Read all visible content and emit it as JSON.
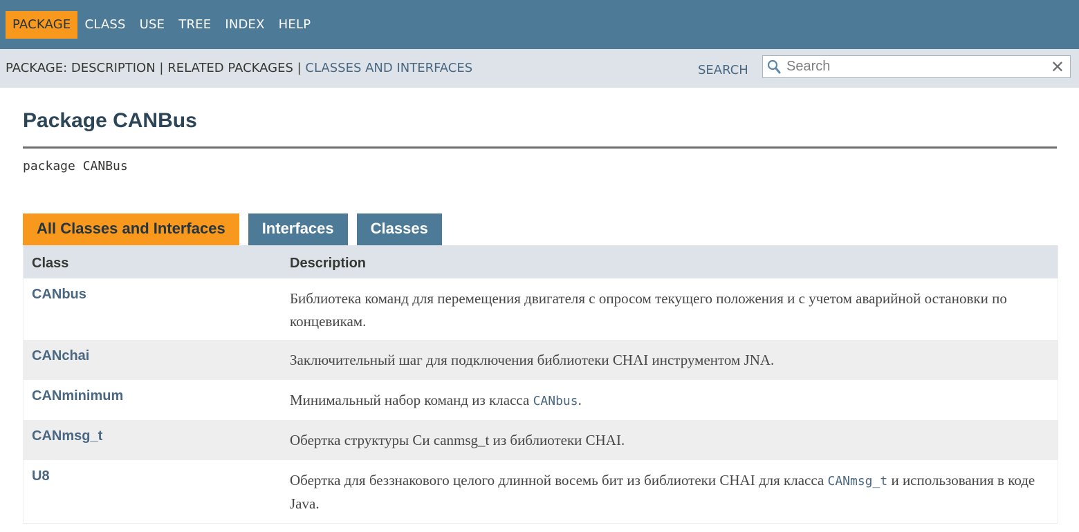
{
  "topnav": {
    "items": [
      {
        "label": "PACKAGE",
        "active": true
      },
      {
        "label": "CLASS",
        "active": false
      },
      {
        "label": "USE",
        "active": false
      },
      {
        "label": "TREE",
        "active": false
      },
      {
        "label": "INDEX",
        "active": false
      },
      {
        "label": "HELP",
        "active": false
      }
    ]
  },
  "subnav": {
    "prefix": "PACKAGE: DESCRIPTION | RELATED PACKAGES | ",
    "link": "CLASSES AND INTERFACES",
    "search_label": "SEARCH",
    "search_placeholder": "Search",
    "clear_glyph": "✕"
  },
  "page": {
    "title": "Package CANBus",
    "signature": "package CANBus"
  },
  "tabs": [
    {
      "label": "All Classes and Interfaces",
      "active": true
    },
    {
      "label": "Interfaces",
      "active": false
    },
    {
      "label": "Classes",
      "active": false
    }
  ],
  "table": {
    "headers": {
      "class": "Class",
      "description": "Description"
    },
    "rows": [
      {
        "name": "CANbus",
        "desc": "Библиотека команд для перемещения двигателя с опросом текущего положения и с учетом аварийной остановки по концевикам."
      },
      {
        "name": "CANchai",
        "desc": "Заключительный шаг для подключения библиотеки CHAI инструментом JNA."
      },
      {
        "name": "CANminimum",
        "desc_before": "Минимальный набор команд из класса ",
        "desc_code": "CANbus",
        "desc_after": "."
      },
      {
        "name": "CANmsg_t",
        "desc": "Обертка структуры Си canmsg_t из библиотеки CHAI."
      },
      {
        "name": "U8",
        "desc_before": "Обертка для беззнакового целого длинной восемь бит из библиотеки CHAI для класса ",
        "desc_code": "CANmsg_t",
        "desc_after": " и использования в коде Java."
      }
    ]
  },
  "colors": {
    "nav_bg": "#4d7a97",
    "accent": "#f8981d",
    "subnav_bg": "#dee3e9",
    "link": "#4a6782",
    "title": "#2c4557"
  }
}
